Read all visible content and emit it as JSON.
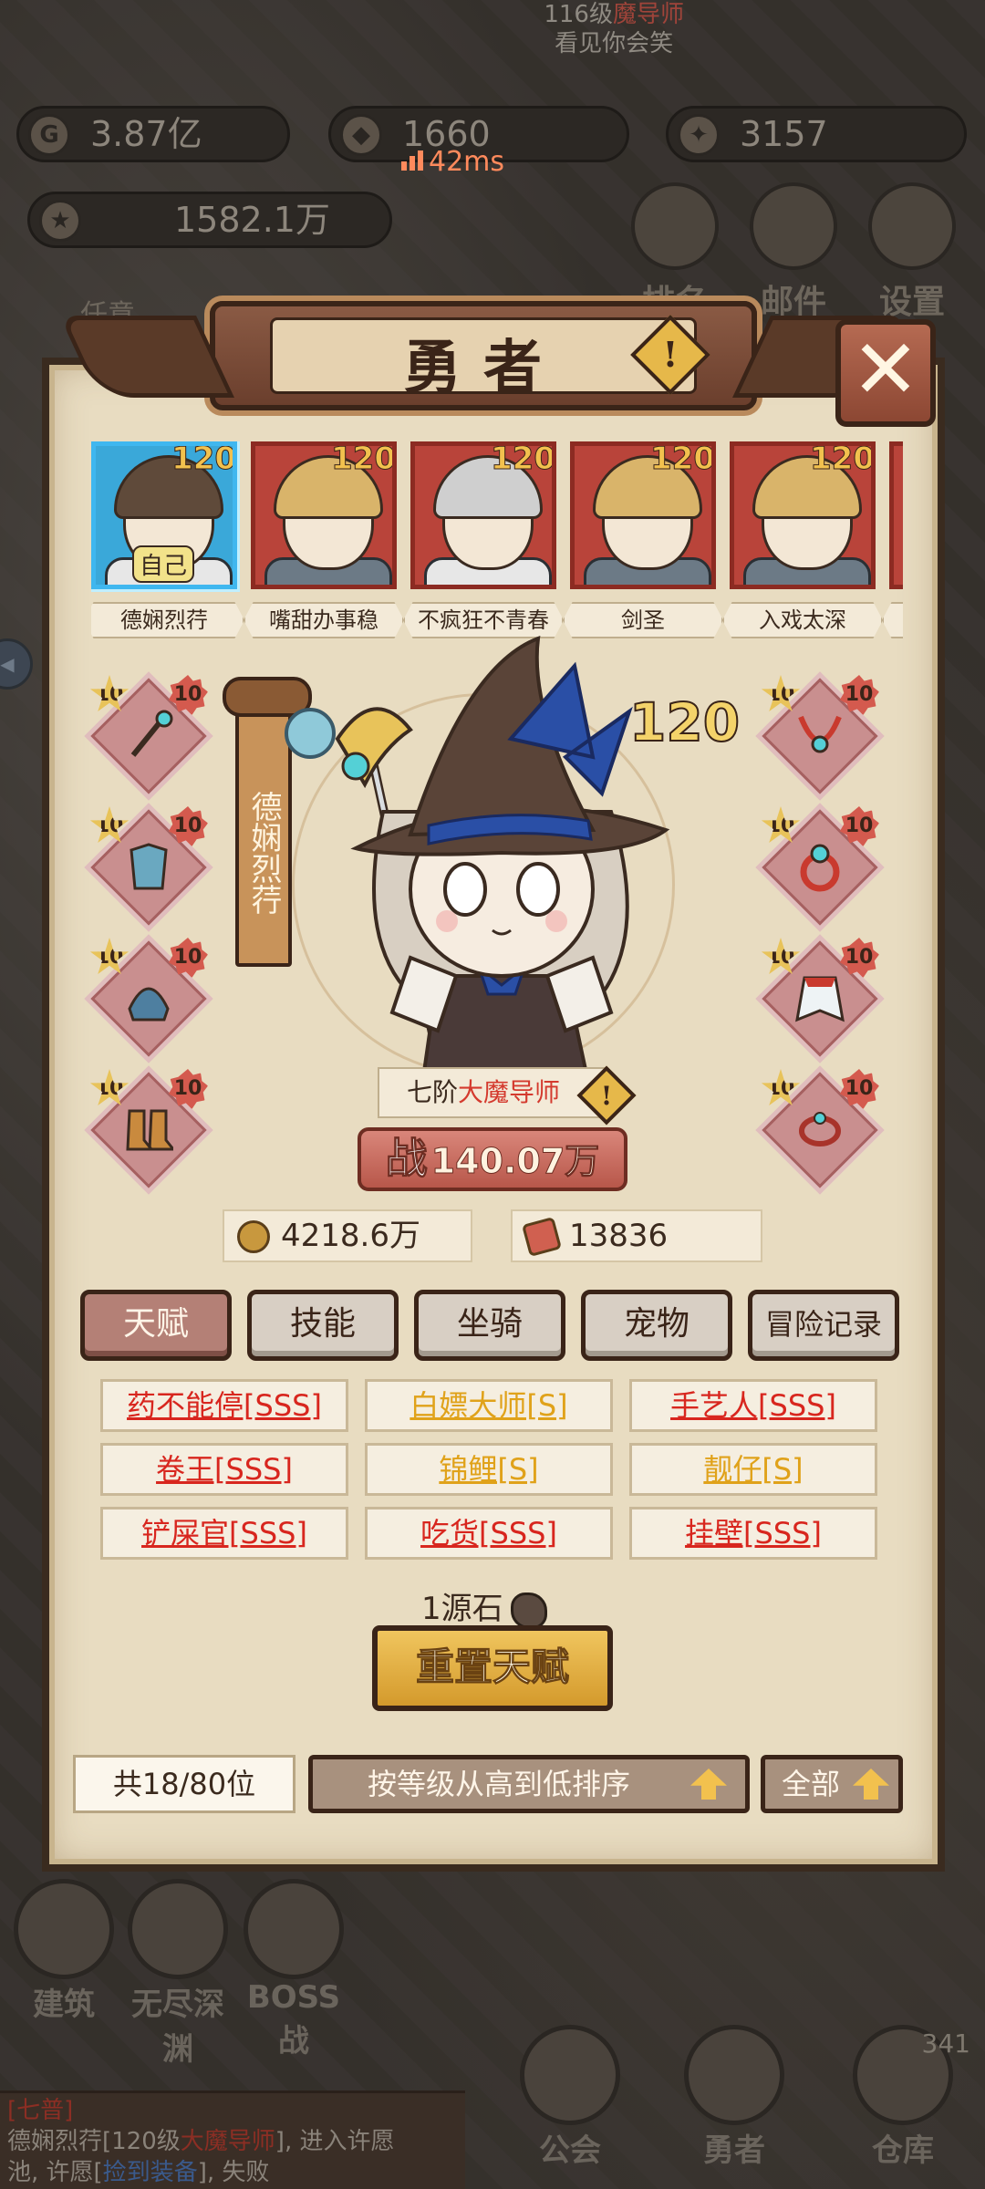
{
  "top_hud": {
    "gold": "3.87亿",
    "crest_value": "1660",
    "gem_value": "3157",
    "power_total": "1582.1万",
    "ping": "42ms",
    "notice_line1": "116级",
    "notice_line1_red": "魔导师",
    "notice_line2": "看见你会笑",
    "quest_label": "任意",
    "side_buttons": [
      "排名",
      "邮件",
      "设置"
    ]
  },
  "panel": {
    "title": "勇者",
    "close_symbol": "✕",
    "warn_symbol": "!"
  },
  "roster": [
    {
      "name": "德娴烈荇",
      "level": "120",
      "self_tag": "自己",
      "hair": "witch",
      "armor": "robe",
      "selected": true
    },
    {
      "name": "嘴甜办事稳",
      "level": "120",
      "self_tag": "",
      "hair": "blonde",
      "armor": "armor",
      "selected": false
    },
    {
      "name": "不疯狂不青春",
      "level": "120",
      "self_tag": "",
      "hair": "grey",
      "armor": "robe",
      "selected": false
    },
    {
      "name": "剑圣",
      "level": "120",
      "self_tag": "",
      "hair": "blonde",
      "armor": "armor",
      "selected": false
    },
    {
      "name": "入戏太深",
      "level": "120",
      "self_tag": "",
      "hair": "blonde",
      "armor": "armor",
      "selected": false
    },
    {
      "name": "另",
      "level": "",
      "self_tag": "",
      "hair": "blonde",
      "armor": "armor",
      "selected": false
    }
  ],
  "equipment": {
    "left": [
      {
        "icon": "staff-icon",
        "star": "10",
        "enhance": "10"
      },
      {
        "icon": "armor-icon",
        "star": "10",
        "enhance": "10"
      },
      {
        "icon": "helmet-icon",
        "star": "10",
        "enhance": "10"
      },
      {
        "icon": "boots-icon",
        "star": "10",
        "enhance": "10"
      }
    ],
    "right": [
      {
        "icon": "necklace-icon",
        "star": "10",
        "enhance": "10"
      },
      {
        "icon": "ring-icon",
        "star": "10",
        "enhance": "10"
      },
      {
        "icon": "cape-icon",
        "star": "10",
        "enhance": "10"
      },
      {
        "icon": "bracelet-icon",
        "star": "10",
        "enhance": "10"
      }
    ]
  },
  "hero": {
    "name": "德娴烈荇",
    "level": "120",
    "rank_prefix": "七阶",
    "rank_class": "大魔导师",
    "power_label": "战",
    "power_value": "140.07万",
    "gold": "4218.6万",
    "cards": "13836"
  },
  "tabs": [
    {
      "label": "天赋",
      "active": true
    },
    {
      "label": "技能",
      "active": false
    },
    {
      "label": "坐骑",
      "active": false
    },
    {
      "label": "宠物",
      "active": false
    },
    {
      "label": "冒险记录",
      "active": false
    }
  ],
  "talents": [
    {
      "label": "药不能停[SSS]",
      "grade": "sss"
    },
    {
      "label": "白嫖大师[S]",
      "grade": "s"
    },
    {
      "label": "手艺人[SSS]",
      "grade": "sss"
    },
    {
      "label": "卷王[SSS]",
      "grade": "sss"
    },
    {
      "label": "锦鲤[S]",
      "grade": "s"
    },
    {
      "label": "靓仔[S]",
      "grade": "s"
    },
    {
      "label": "铲屎官[SSS]",
      "grade": "sss"
    },
    {
      "label": "吃货[SSS]",
      "grade": "sss"
    },
    {
      "label": "挂壁[SSS]",
      "grade": "sss"
    }
  ],
  "reset": {
    "cost": "1源石",
    "button": "重置天赋"
  },
  "footer": {
    "count": "共18/80位",
    "sort": "按等级从高到低排序",
    "filter": "全部"
  },
  "bottom_nav": {
    "items": [
      "建筑",
      "无尽深渊",
      "BOSS战",
      "公会",
      "勇者",
      "仓库"
    ],
    "badge": "341",
    "chat": {
      "tag": "[七普]",
      "line1_a": "德娴烈荇[120级",
      "line1_red": "大魔导师",
      "line1_b": "], 进入许愿",
      "line2_a": "池, 许愿[",
      "line2_blue": "捡到装备",
      "line2_b": "], 失败"
    }
  },
  "colors": {
    "sss": "#d8261e",
    "s": "#e0a21a",
    "panel_bg": "#e8dcc1",
    "accent_red": "#d43a2e"
  }
}
